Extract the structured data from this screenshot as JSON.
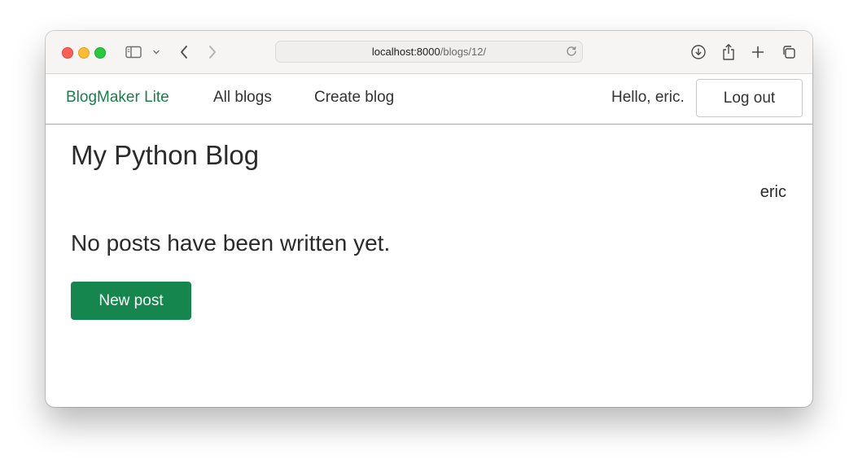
{
  "browser": {
    "url_host": "localhost:8000",
    "url_path": "/blogs/12/"
  },
  "navbar": {
    "brand": "BlogMaker Lite",
    "links": [
      "All blogs",
      "Create blog"
    ],
    "greeting": "Hello, eric.",
    "logout_label": "Log out"
  },
  "main": {
    "title": "My Python Blog",
    "owner": "eric",
    "empty_message": "No posts have been written yet.",
    "new_post_label": "New post"
  },
  "colors": {
    "brand": "#1a7f4b",
    "primary_button": "#16864f"
  }
}
